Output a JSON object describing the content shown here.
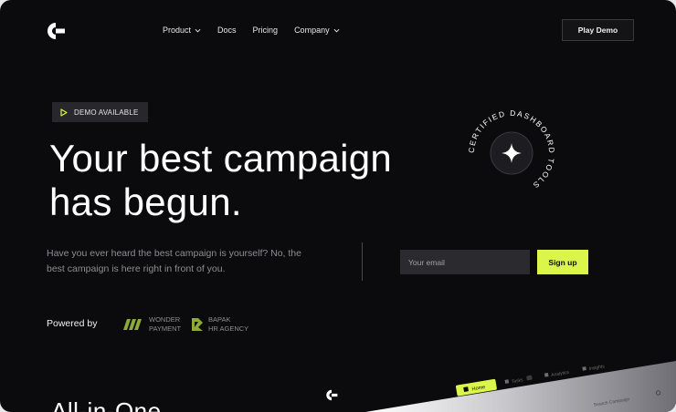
{
  "nav": {
    "items": [
      {
        "label": "Product",
        "dropdown": true
      },
      {
        "label": "Docs",
        "dropdown": false
      },
      {
        "label": "Pricing",
        "dropdown": false
      },
      {
        "label": "Company",
        "dropdown": true
      }
    ],
    "cta_label": "Play Demo"
  },
  "hero": {
    "badge_label": "DEMO AVAILABLE",
    "headline_line1": "Your best campaign",
    "headline_line2": "has begun.",
    "subtext_line1": "Have you ever heard the best campaign is yourself? No, the",
    "subtext_line2": "best campaign is here right in front of you.",
    "email_placeholder": "Your email",
    "signup_label": "Sign up",
    "circle_text": "CERTIFIED DASHBOARD TOOLS"
  },
  "partners": {
    "powered_by_label": "Powered by",
    "items": [
      {
        "line1": "WONDER",
        "line2": "PAYMENT"
      },
      {
        "line1": "BAPAK",
        "line2": "HR AGENCY"
      }
    ]
  },
  "preview": {
    "home_label": "Home",
    "nav_items": [
      "Tasks",
      "Analytics",
      "Insights"
    ],
    "search_placeholder": "Search Campaign"
  },
  "next_section_title": "All-in-One",
  "colors": {
    "background": "#0b0a0d",
    "accent": "#dcf54a",
    "muted_text": "#8e8d93"
  }
}
